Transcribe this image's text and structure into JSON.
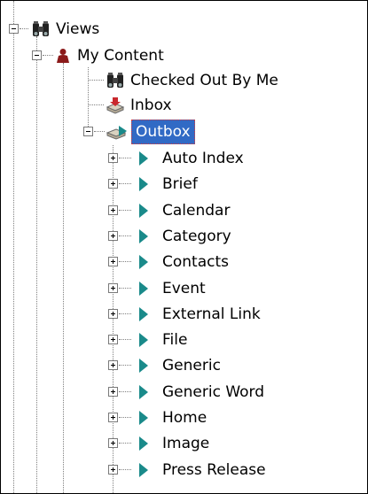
{
  "tree": {
    "views": {
      "label": "Views",
      "icon": "binoculars-icon"
    },
    "my_content": {
      "label": "My Content",
      "icon": "user-icon"
    },
    "checked_out": {
      "label": "Checked Out By Me",
      "icon": "binoculars-icon"
    },
    "inbox": {
      "label": "Inbox",
      "icon": "inbox-icon"
    },
    "outbox": {
      "label": "Outbox",
      "icon": "outbox-icon",
      "selected": true
    },
    "items": [
      {
        "label": "Auto Index"
      },
      {
        "label": "Brief"
      },
      {
        "label": "Calendar"
      },
      {
        "label": "Category"
      },
      {
        "label": "Contacts"
      },
      {
        "label": "Event"
      },
      {
        "label": "External Link"
      },
      {
        "label": "File"
      },
      {
        "label": "Generic"
      },
      {
        "label": "Generic Word"
      },
      {
        "label": "Home"
      },
      {
        "label": "Image"
      },
      {
        "label": "Press Release"
      }
    ]
  },
  "colors": {
    "selection": "#316ac5",
    "arrow": "#1a8a8a",
    "user": "#8b1a1a"
  }
}
